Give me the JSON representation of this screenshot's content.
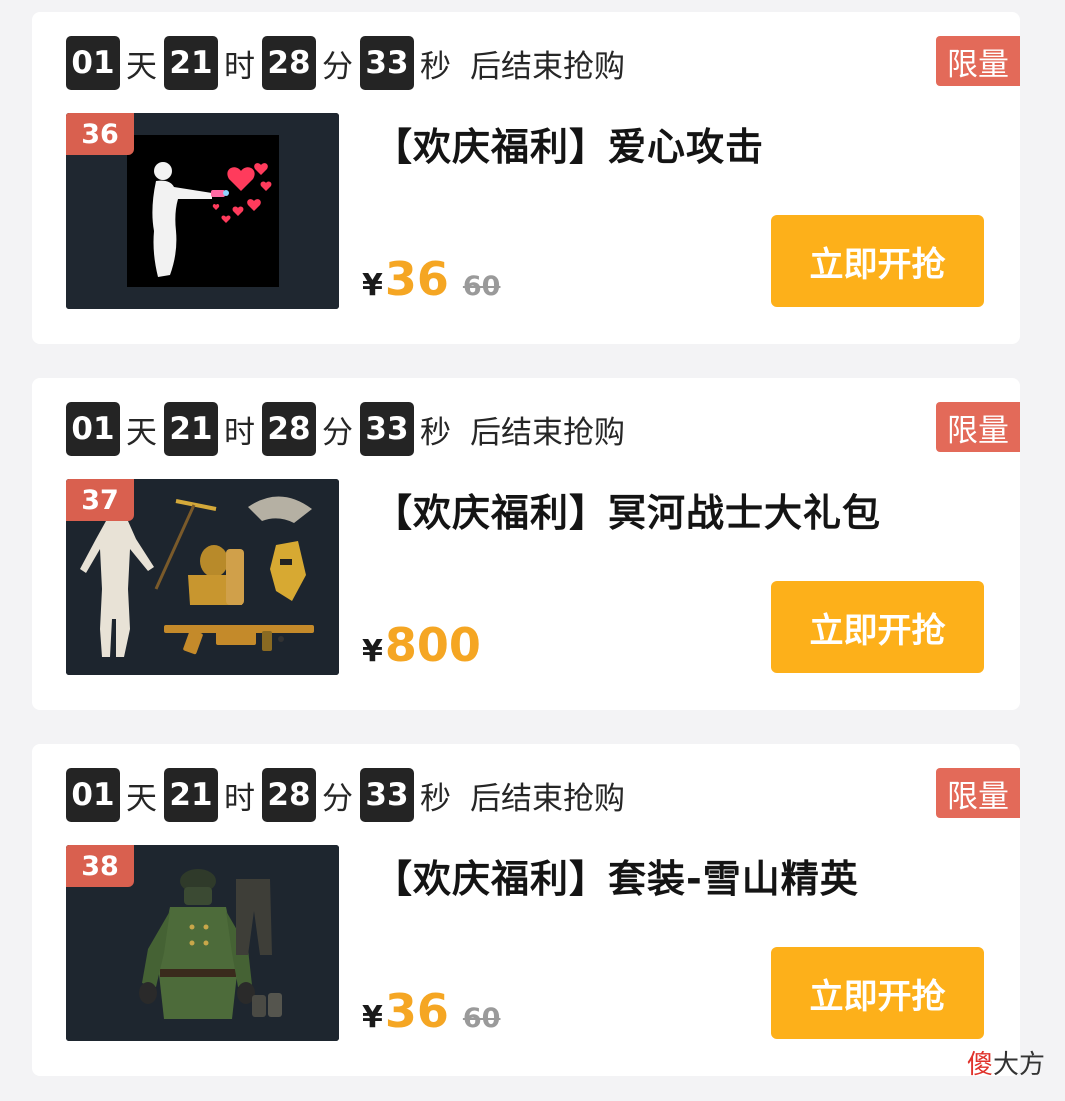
{
  "items": [
    {
      "countdown": {
        "days": "01",
        "day_unit": "天",
        "hours": "21",
        "hour_unit": "时",
        "minutes": "28",
        "minute_unit": "分",
        "seconds": "33",
        "second_unit": "秒",
        "suffix": "后结束抢购"
      },
      "badge": "限量",
      "rank": "36",
      "title": "【欢庆福利】爱心攻击",
      "price": {
        "symbol": "¥",
        "current": "36",
        "original": "60"
      },
      "button": "立即开抢"
    },
    {
      "countdown": {
        "days": "01",
        "day_unit": "天",
        "hours": "21",
        "hour_unit": "时",
        "minutes": "28",
        "minute_unit": "分",
        "seconds": "33",
        "second_unit": "秒",
        "suffix": "后结束抢购"
      },
      "badge": "限量",
      "rank": "37",
      "title": "【欢庆福利】冥河战士大礼包",
      "price": {
        "symbol": "¥",
        "current": "800",
        "original": ""
      },
      "button": "立即开抢"
    },
    {
      "countdown": {
        "days": "01",
        "day_unit": "天",
        "hours": "21",
        "hour_unit": "时",
        "minutes": "28",
        "minute_unit": "分",
        "seconds": "33",
        "second_unit": "秒",
        "suffix": "后结束抢购"
      },
      "badge": "限量",
      "rank": "38",
      "title": "【欢庆福利】套装-雪山精英",
      "price": {
        "symbol": "¥",
        "current": "36",
        "original": "60"
      },
      "button": "立即开抢"
    }
  ],
  "watermark": {
    "part1": "傻",
    "part2": "大方"
  },
  "colors": {
    "accent": "#fdb01a",
    "price": "#f5a623",
    "badge": "#e36a59",
    "rank_tag": "#d9604f",
    "countdown_box": "#242424"
  }
}
